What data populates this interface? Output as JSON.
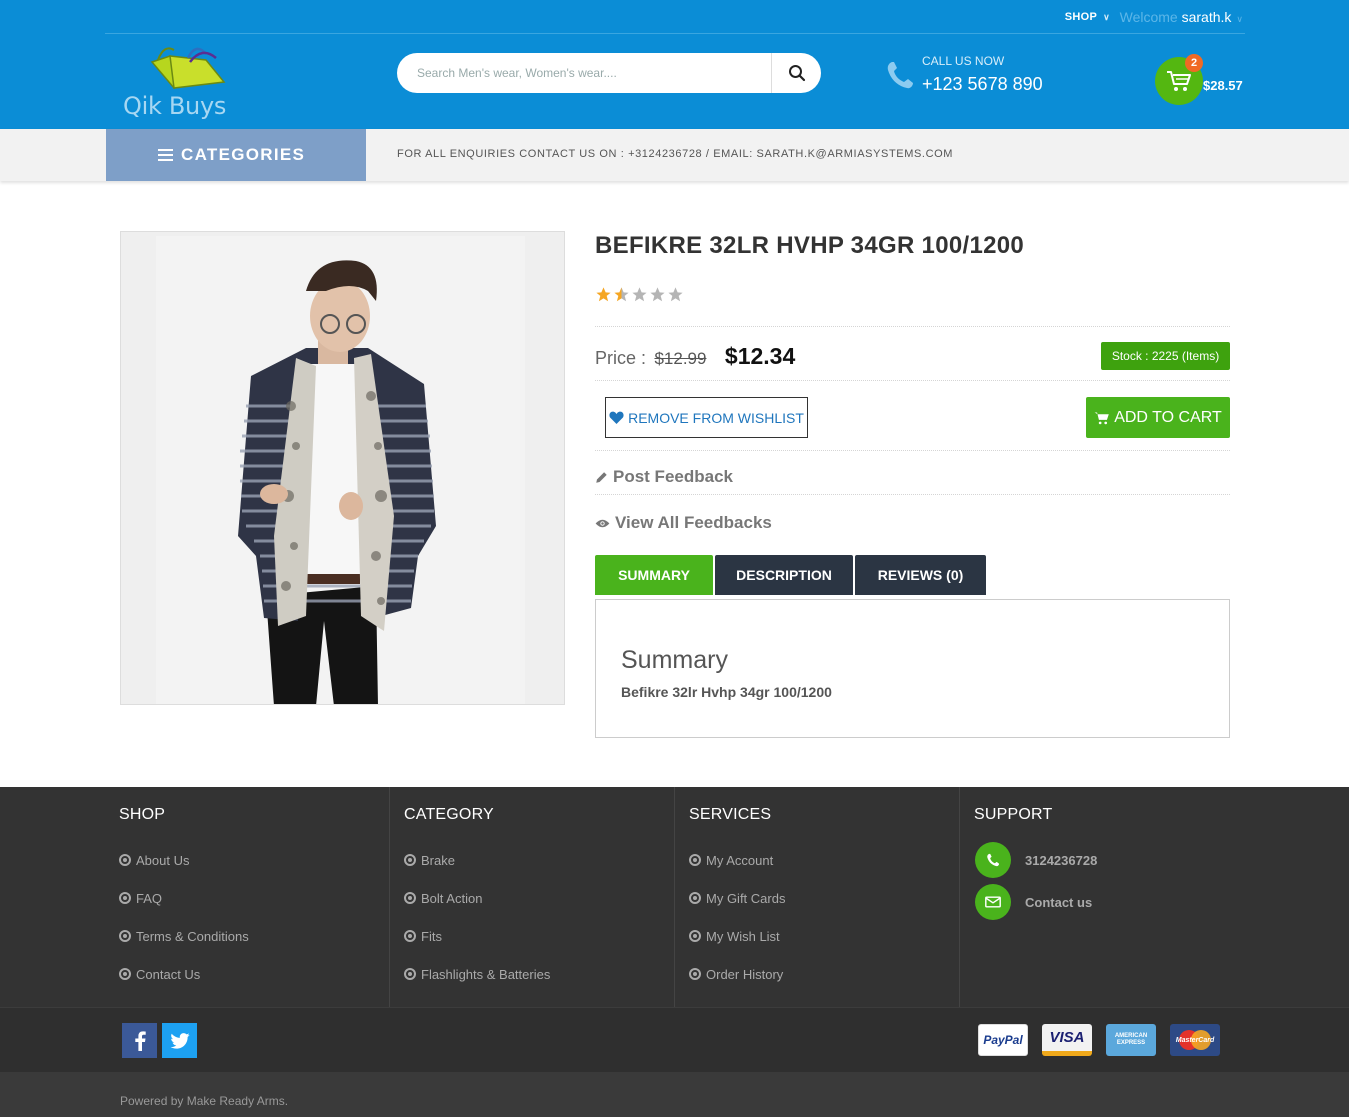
{
  "topbar": {
    "shop_label": "SHOP",
    "welcome_word": "Welcome",
    "user_name": "sarath.k"
  },
  "header": {
    "brand": "Qik Buys",
    "search_placeholder": "Search Men's wear, Women's wear....",
    "call_label": "CALL US NOW",
    "call_number": "+123 5678 890",
    "cart_count": "2",
    "cart_total": "$28.57"
  },
  "catbar": {
    "categories_label": "CATEGORIES",
    "enquiry_text": "FOR ALL ENQUIRIES CONTACT US ON : +3124236728 / EMAIL: SARATH.K@ARMIASYSTEMS.COM"
  },
  "product": {
    "title": "BEFIKRE 32LR HVHP 34GR 100/1200",
    "rating": 1.5,
    "rating_max": 5,
    "price_label": "Price :",
    "old_price": "$12.99",
    "new_price": "$12.34",
    "stock_text": "Stock : 2225 (Items)",
    "wishlist_label": "REMOVE FROM WISHLIST",
    "add_to_cart_label": "ADD TO CART",
    "post_feedback_label": "Post Feedback",
    "view_feedbacks_label": "View All Feedbacks",
    "tabs": [
      {
        "label": "SUMMARY",
        "active": true
      },
      {
        "label": "DESCRIPTION",
        "active": false
      },
      {
        "label": "REVIEWS (0)",
        "active": false
      }
    ],
    "summary_heading": "Summary",
    "summary_text": "Befikre 32lr Hvhp 34gr 100/1200"
  },
  "footer": {
    "columns": [
      {
        "title": "SHOP",
        "items": [
          "About Us",
          "FAQ",
          "Terms & Conditions",
          "Contact Us"
        ]
      },
      {
        "title": "CATEGORY",
        "items": [
          "Brake",
          "Bolt Action",
          "Fits",
          "Flashlights & Batteries"
        ]
      },
      {
        "title": "SERVICES",
        "items": [
          "My Account",
          "My Gift Cards",
          "My Wish List",
          "Order History"
        ]
      }
    ],
    "support": {
      "title": "SUPPORT",
      "phone": "3124236728",
      "contact": "Contact us"
    },
    "payment_cards": [
      "PayPal",
      "VISA",
      "AMERICAN EXPRESS",
      "MasterCard"
    ],
    "powered_by": "Powered by Make Ready Arms."
  },
  "colors": {
    "header_blue": "#0b8dd6",
    "green": "#4ab31c",
    "dark_tab": "#2b3543",
    "category_btn": "#7e9fc8",
    "footer_bg": "#333333",
    "star_gold": "#f5a623"
  }
}
